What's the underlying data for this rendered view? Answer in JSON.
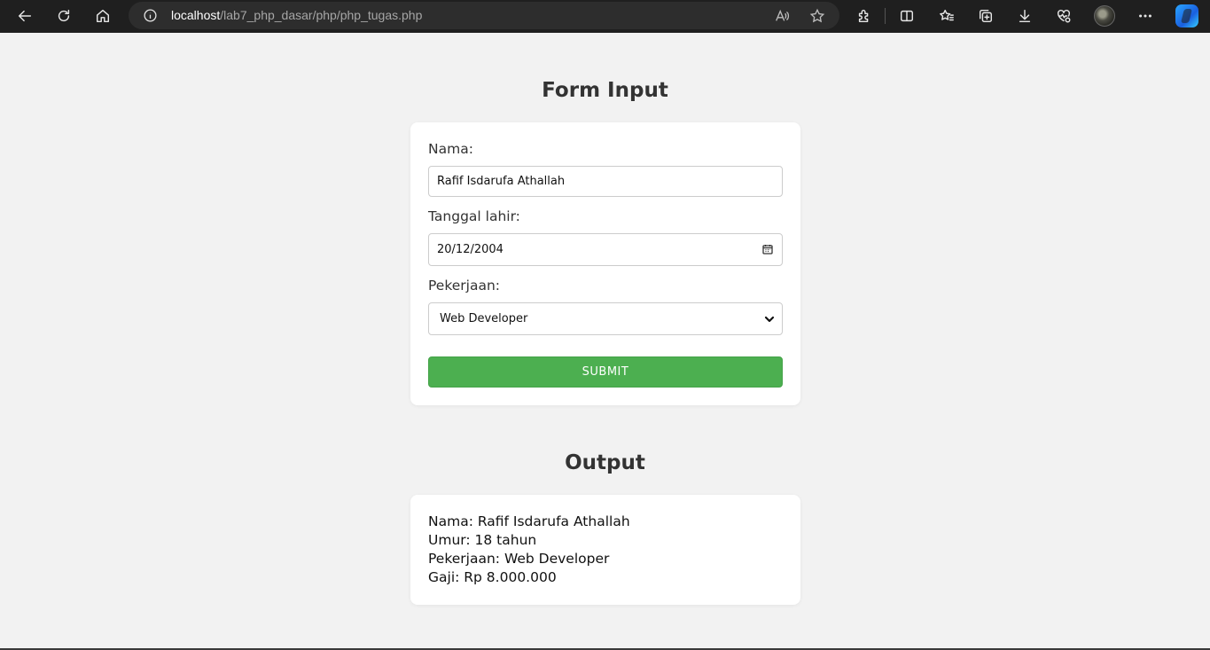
{
  "browser": {
    "url_host": "localhost",
    "url_path": "/lab7_php_dasar/php/php_tugas.php"
  },
  "form": {
    "heading": "Form Input",
    "nama_label": "Nama:",
    "nama_value": "Rafif Isdarufa Athallah",
    "tanggal_label": "Tanggal lahir:",
    "tanggal_value": "20/12/2004",
    "pekerjaan_label": "Pekerjaan:",
    "pekerjaan_value": "Web Developer",
    "submit_label": "SUBMIT"
  },
  "output": {
    "heading": "Output",
    "lines": [
      "Nama: Rafif Isdarufa Athallah",
      "Umur: 18 tahun",
      "Pekerjaan: Web Developer",
      "Gaji: Rp 8.000.000"
    ]
  },
  "colors": {
    "accent": "#4caf50",
    "page_bg": "#f2f2f2",
    "chrome_bg": "#1f1f1f"
  }
}
